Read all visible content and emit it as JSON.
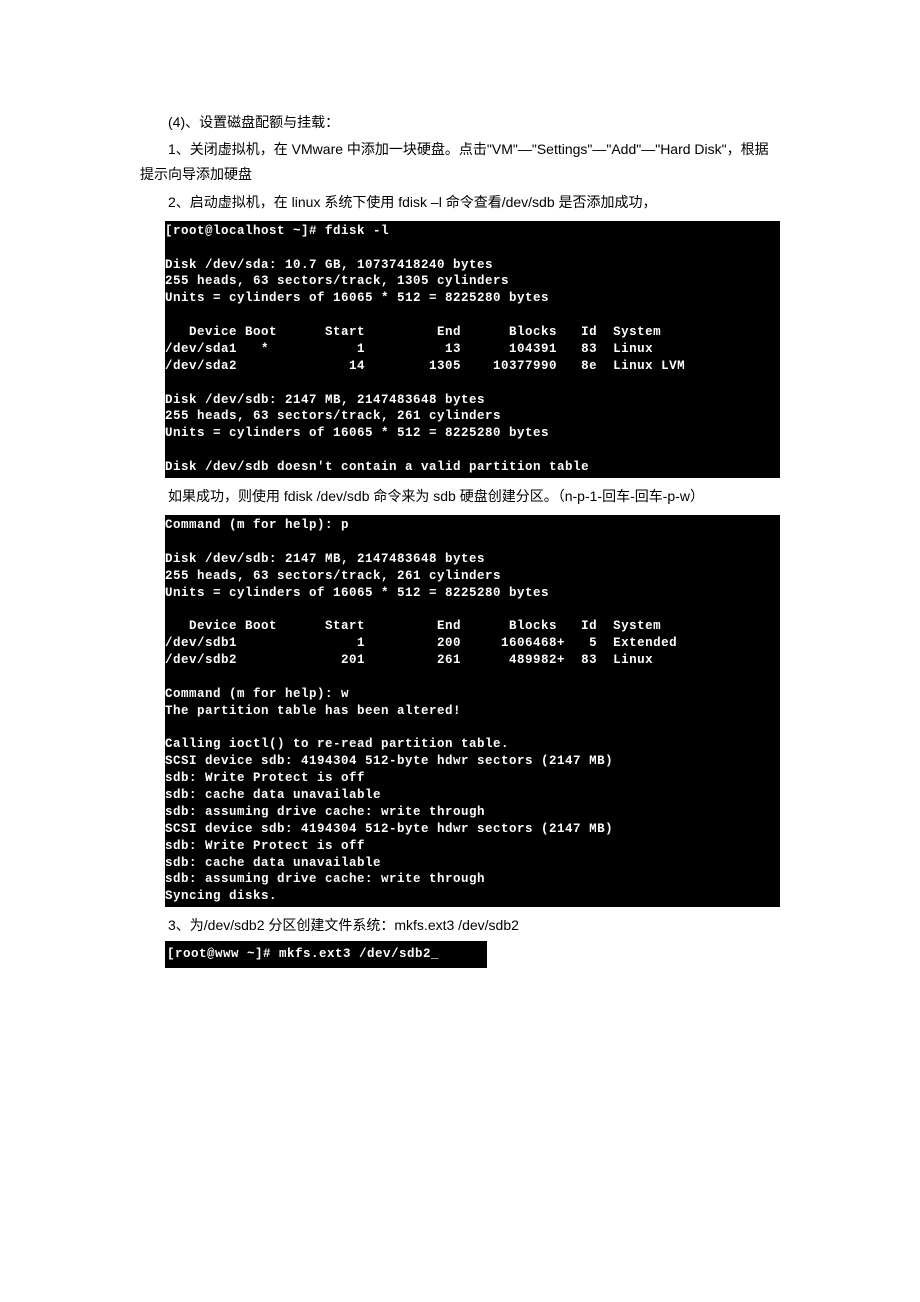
{
  "p1": "(4)、设置磁盘配额与挂载：",
  "p2": "1、关闭虚拟机，在 VMware 中添加一块硬盘。点击\"VM\"—\"Settings\"—\"Add\"—\"Hard Disk\"，根据提示向导添加硬盘",
  "p3": "2、启动虚拟机，在 linux 系统下使用 fdisk –l 命令查看/dev/sdb 是否添加成功，",
  "term1": "[root@localhost ~]# fdisk -l\n\nDisk /dev/sda: 10.7 GB, 10737418240 bytes\n255 heads, 63 sectors/track, 1305 cylinders\nUnits = cylinders of 16065 * 512 = 8225280 bytes\n\n   Device Boot      Start         End      Blocks   Id  System\n/dev/sda1   *           1          13      104391   83  Linux\n/dev/sda2              14        1305    10377990   8e  Linux LVM\n\nDisk /dev/sdb: 2147 MB, 2147483648 bytes\n255 heads, 63 sectors/track, 261 cylinders\nUnits = cylinders of 16065 * 512 = 8225280 bytes\n\nDisk /dev/sdb doesn't contain a valid partition table",
  "p4": "如果成功，则使用 fdisk /dev/sdb  命令来为 sdb 硬盘创建分区。（n-p-1-回车-回车-p-w）",
  "term2": "Command (m for help): p\n\nDisk /dev/sdb: 2147 MB, 2147483648 bytes\n255 heads, 63 sectors/track, 261 cylinders\nUnits = cylinders of 16065 * 512 = 8225280 bytes\n\n   Device Boot      Start         End      Blocks   Id  System\n/dev/sdb1               1         200     1606468+   5  Extended\n/dev/sdb2             201         261      489982+  83  Linux\n\nCommand (m for help): w\nThe partition table has been altered!\n\nCalling ioctl() to re-read partition table.\nSCSI device sdb: 4194304 512-byte hdwr sectors (2147 MB)\nsdb: Write Protect is off\nsdb: cache data unavailable\nsdb: assuming drive cache: write through\nSCSI device sdb: 4194304 512-byte hdwr sectors (2147 MB)\nsdb: Write Protect is off\nsdb: cache data unavailable\nsdb: assuming drive cache: write through\nSyncing disks.",
  "p5": "3、为/dev/sdb2 分区创建文件系统：mkfs.ext3 /dev/sdb2",
  "term3": "[root@www ~]# mkfs.ext3 /dev/sdb2_     "
}
